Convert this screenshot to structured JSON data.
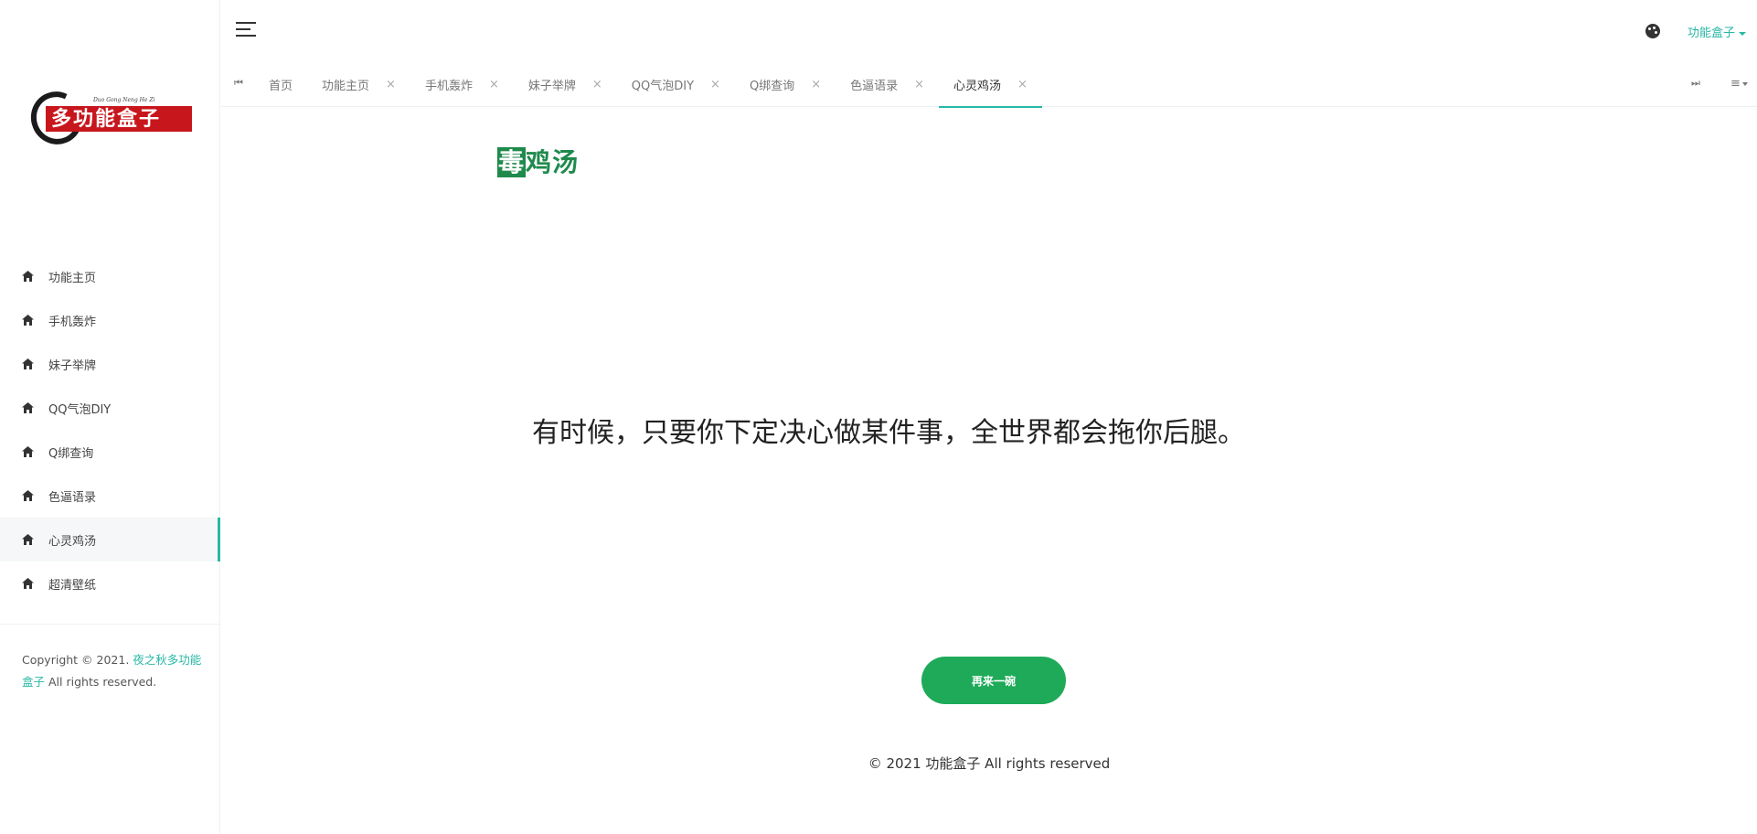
{
  "logo": {
    "text": "多功能盒子",
    "subtitle": "Duo Gong Neng He Zi"
  },
  "sidebar": {
    "items": [
      {
        "label": "功能主页"
      },
      {
        "label": "手机轰炸"
      },
      {
        "label": "妹子举牌"
      },
      {
        "label": "QQ气泡DIY"
      },
      {
        "label": "Q绑查询"
      },
      {
        "label": "色逼语录"
      },
      {
        "label": "心灵鸡汤",
        "active": true
      },
      {
        "label": "超清壁纸"
      }
    ],
    "copyright_prefix": "Copyright © 2021.",
    "copyright_link": "夜之秋多功能盒子",
    "copyright_suffix": "All rights reserved."
  },
  "header": {
    "user_menu_label": "功能盒子"
  },
  "tabs": [
    {
      "label": "首页",
      "closable": false
    },
    {
      "label": "功能主页",
      "closable": true
    },
    {
      "label": "手机轰炸",
      "closable": true
    },
    {
      "label": "妹子举牌",
      "closable": true
    },
    {
      "label": "QQ气泡DIY",
      "closable": true
    },
    {
      "label": "Q绑查询",
      "closable": true
    },
    {
      "label": "色逼语录",
      "closable": true
    },
    {
      "label": "心灵鸡汤",
      "closable": true,
      "active": true
    }
  ],
  "tab_close_glyph": "×",
  "main": {
    "logo_boxed_char": "毒",
    "logo_rest": "鸡汤",
    "quote": "有时候，只要你下定决心做某件事，全世界都会拖你后腿。",
    "again_button_label": "再来一碗",
    "footer": "© 2021 功能盒子 All rights reserved"
  },
  "colors": {
    "accent": "#27b8a6",
    "button": "#1faa59",
    "brand_green": "#1f8a4c",
    "logo_red": "#c8161d"
  }
}
